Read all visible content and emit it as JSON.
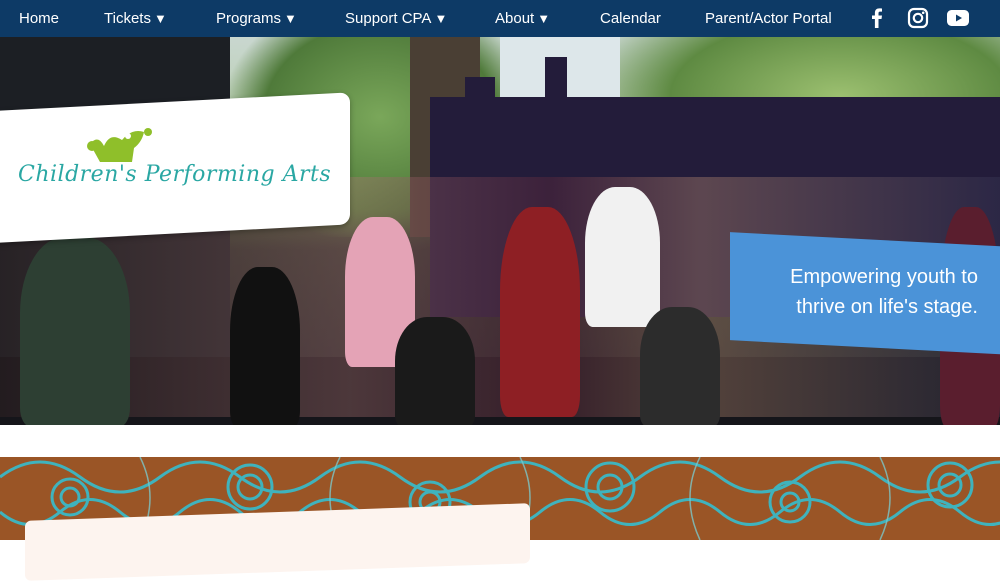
{
  "nav": {
    "items": [
      {
        "label": "Home",
        "dropdown": false
      },
      {
        "label": "Tickets",
        "dropdown": true
      },
      {
        "label": "Programs",
        "dropdown": true
      },
      {
        "label": "Support CPA",
        "dropdown": true
      },
      {
        "label": "About",
        "dropdown": true
      },
      {
        "label": "Calendar",
        "dropdown": false
      },
      {
        "label": "Parent/Actor Portal",
        "dropdown": false
      }
    ],
    "caret": "▼",
    "social": [
      "facebook-icon",
      "instagram-icon",
      "youtube-icon"
    ]
  },
  "hero": {
    "logo_text": "Children's Performing Arts",
    "tagline_line1": "Empowering youth to",
    "tagline_line2": "thrive on life's stage."
  },
  "colors": {
    "nav_bg": "#0d3a66",
    "logo_teal": "#2aa7a3",
    "logo_green": "#8fbf2a",
    "tagline_bg": "#4b93d8",
    "pattern_bg": "#9a5526",
    "pattern_teal": "#3fb3bd"
  }
}
